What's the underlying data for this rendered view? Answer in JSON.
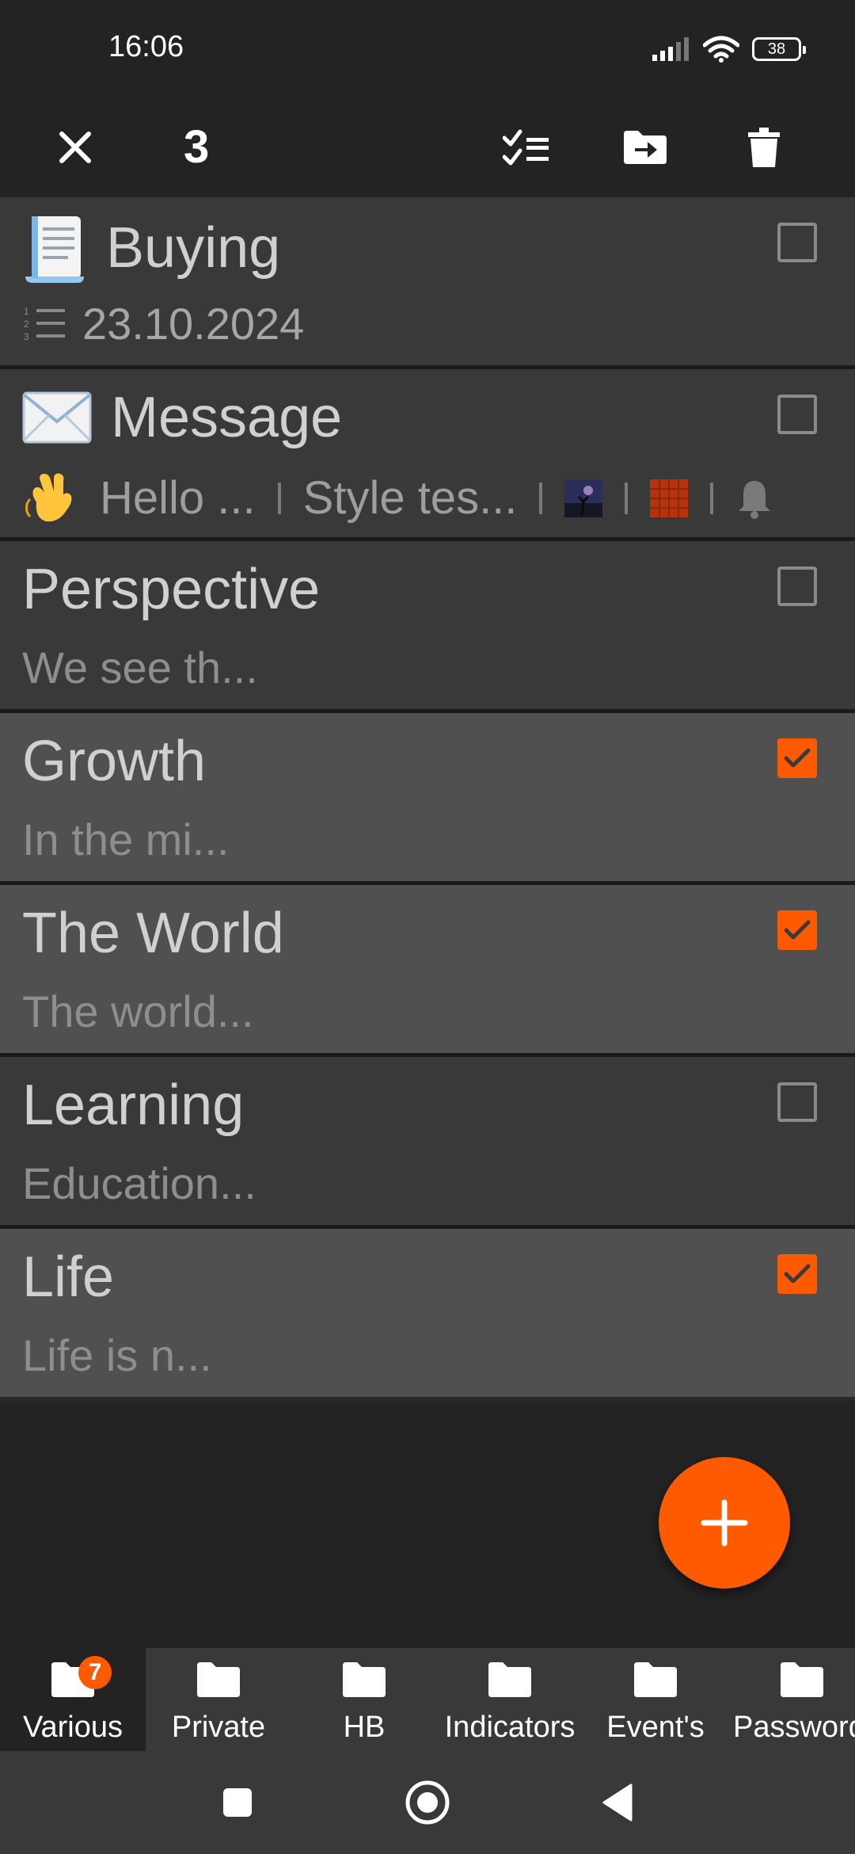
{
  "status_bar": {
    "time": "16:06",
    "battery": "38"
  },
  "toolbar": {
    "selected_count": "3"
  },
  "notes": [
    {
      "title": "Buying",
      "title_icon": "scroll-emoji",
      "subtitle": "23.10.2024",
      "subtitle_icon": "numbered-list-icon",
      "selected": false
    },
    {
      "title": "Message",
      "title_icon": "envelope-emoji",
      "sub_parts": [
        "Hello ...",
        "Style tes..."
      ],
      "selected": false
    },
    {
      "title": "Perspective",
      "subtitle": "We see th...",
      "selected": false
    },
    {
      "title": "Growth",
      "subtitle": "In the mi...",
      "selected": true
    },
    {
      "title": "The World",
      "subtitle": "The world...",
      "selected": true
    },
    {
      "title": "Learning",
      "subtitle": "Education...",
      "selected": false
    },
    {
      "title": "Life",
      "subtitle": "Life is n...",
      "selected": true
    }
  ],
  "tabs": [
    {
      "label": "Various",
      "badge": "7",
      "active": true
    },
    {
      "label": "Private"
    },
    {
      "label": "HB"
    },
    {
      "label": "Indicators"
    },
    {
      "label": "Event's"
    },
    {
      "label": "Passwords"
    }
  ],
  "colors": {
    "accent": "#ff5a00",
    "background": "#232323",
    "item": "#393939",
    "item_selected": "#505050"
  }
}
